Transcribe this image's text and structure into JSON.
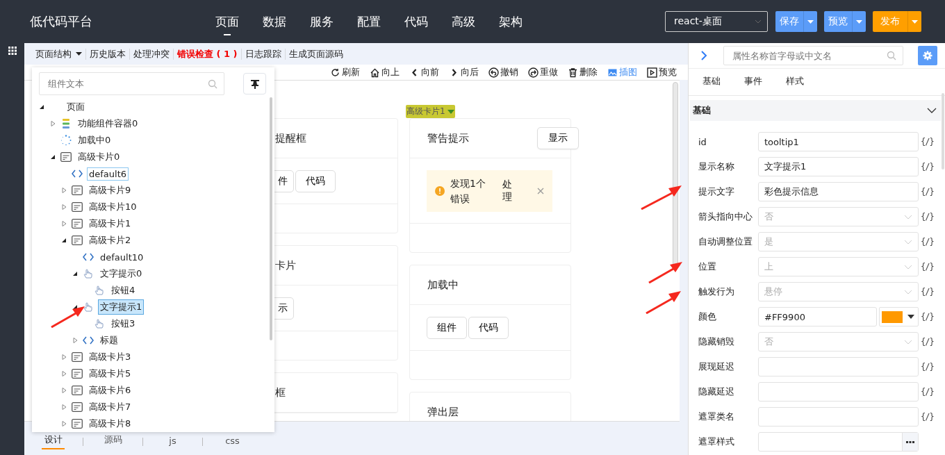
{
  "header": {
    "title": "低代码平台",
    "nav": [
      {
        "label": "页面",
        "selected": true
      },
      {
        "label": "数据",
        "selected": false
      },
      {
        "label": "服务",
        "selected": false
      },
      {
        "label": "配置",
        "selected": false
      },
      {
        "label": "代码",
        "selected": false
      },
      {
        "label": "高级",
        "selected": false
      },
      {
        "label": "架构",
        "selected": false
      }
    ],
    "env_select": {
      "value": "react-桌面"
    },
    "buttons": [
      {
        "label": "保存",
        "kind": "primary"
      },
      {
        "label": "预览",
        "kind": "primary"
      },
      {
        "label": "发布",
        "kind": "warning"
      }
    ]
  },
  "subtoolbar": [
    {
      "label": "页面结构",
      "kind": "dropdown"
    },
    {
      "label": "历史版本",
      "kind": "plain"
    },
    {
      "label": "处理冲突",
      "kind": "plain"
    },
    {
      "label": "错误检查 ( 1 )",
      "kind": "error"
    },
    {
      "label": "日志跟踪",
      "kind": "plain"
    },
    {
      "label": "生成页面源码",
      "kind": "plain"
    }
  ],
  "structure_panel": {
    "search": {
      "placeholder": "组件文本"
    },
    "tree": [
      {
        "label": "页面",
        "expanded": true,
        "selected": false,
        "hovered": false,
        "children": [
          {
            "label": "功能组件容器0",
            "kind": "container",
            "expanded": false,
            "selected": false,
            "hovered": false
          },
          {
            "label": "加载中0",
            "kind": "loading",
            "selected": false,
            "hovered": false
          },
          {
            "label": "高级卡片0",
            "kind": "card",
            "expanded": true,
            "selected": false,
            "hovered": false,
            "children": [
              {
                "label": "default6",
                "kind": "slot",
                "selected": false,
                "hovered": true
              },
              {
                "label": "高级卡片9",
                "kind": "card",
                "expanded": false,
                "selected": false,
                "hovered": false
              },
              {
                "label": "高级卡片10",
                "kind": "card",
                "expanded": false,
                "selected": false,
                "hovered": false
              },
              {
                "label": "高级卡片1",
                "kind": "card",
                "expanded": false,
                "selected": false,
                "hovered": false
              },
              {
                "label": "高级卡片2",
                "kind": "card",
                "expanded": true,
                "selected": false,
                "hovered": false,
                "children": [
                  {
                    "label": "default10",
                    "kind": "slot",
                    "selected": false,
                    "hovered": false
                  },
                  {
                    "label": "文字提示0",
                    "kind": "pointer",
                    "expanded": true,
                    "selected": false,
                    "hovered": false,
                    "children": [
                      {
                        "label": "按钮4",
                        "kind": "pointer",
                        "selected": false,
                        "hovered": false
                      }
                    ]
                  },
                  {
                    "label": "文字提示1",
                    "kind": "pointer",
                    "expanded": true,
                    "selected": true,
                    "hovered": false,
                    "children": [
                      {
                        "label": "按钮3",
                        "kind": "pointer",
                        "selected": false,
                        "hovered": false
                      }
                    ]
                  },
                  {
                    "label": "标题",
                    "kind": "slot",
                    "expanded": false,
                    "selected": false,
                    "hovered": false
                  }
                ]
              },
              {
                "label": "高级卡片3",
                "kind": "card",
                "expanded": false,
                "selected": false,
                "hovered": false
              },
              {
                "label": "高级卡片5",
                "kind": "card",
                "expanded": false,
                "selected": false,
                "hovered": false
              },
              {
                "label": "高级卡片6",
                "kind": "card",
                "expanded": false,
                "selected": false,
                "hovered": false
              },
              {
                "label": "高级卡片7",
                "kind": "card",
                "expanded": false,
                "selected": false,
                "hovered": false
              },
              {
                "label": "高级卡片8",
                "kind": "card",
                "expanded": false,
                "selected": false,
                "hovered": false
              }
            ]
          }
        ]
      }
    ]
  },
  "canvas": {
    "actions": [
      {
        "label": "刷新",
        "kind": "refresh",
        "active": false
      },
      {
        "label": "向上",
        "kind": "home",
        "active": false
      },
      {
        "label": "向前",
        "kind": "prev",
        "active": false
      },
      {
        "label": "向后",
        "kind": "next",
        "active": false
      },
      {
        "label": "撤销",
        "kind": "undo",
        "active": false
      },
      {
        "label": "重做",
        "kind": "redo",
        "active": false
      },
      {
        "label": "删除",
        "kind": "delete",
        "active": false
      },
      {
        "label": "插图",
        "kind": "image",
        "active": true
      },
      {
        "label": "预览",
        "kind": "play",
        "active": false
      }
    ],
    "selection_tag": "高级卡片1",
    "card_columns": [
      [
        {
          "title": "提醒框",
          "buttons": [
            "件",
            "代码"
          ]
        },
        {
          "title": "卡片",
          "buttons": [
            "示"
          ]
        },
        {
          "title": "框"
        }
      ],
      [
        {
          "title": "警告提示",
          "header_button": "显示",
          "alert": {
            "text": "发现1个错误",
            "action": "处理"
          }
        },
        {
          "title": "加载中",
          "buttons": [
            "组件",
            "代码"
          ]
        },
        {
          "title": "弹出层"
        }
      ]
    ]
  },
  "bottom_tabs": [
    {
      "label": "设计",
      "selected": true
    },
    {
      "label": "源码",
      "selected": false
    },
    {
      "label": "js",
      "selected": false
    },
    {
      "label": "css",
      "selected": false
    }
  ],
  "properties": {
    "search": {
      "placeholder": "属性名称首字母或中文名"
    },
    "tabs": [
      {
        "label": "基础"
      },
      {
        "label": "事件"
      },
      {
        "label": "样式"
      }
    ],
    "section": {
      "title": "基础",
      "expanded": true
    },
    "fields": [
      {
        "label": "id",
        "kind": "text",
        "value": "tooltip1",
        "binding": "{/}"
      },
      {
        "label": "显示名称",
        "kind": "text",
        "value": "文字提示1",
        "binding": "{/}"
      },
      {
        "label": "提示文字",
        "kind": "text",
        "value": "彩色提示信息",
        "binding": "{/}"
      },
      {
        "label": "箭头指向中心",
        "kind": "select",
        "placeholder": "否",
        "binding": "{/}"
      },
      {
        "label": "自动调整位置",
        "kind": "select",
        "placeholder": "是",
        "binding": "{/}"
      },
      {
        "label": "位置",
        "kind": "select",
        "placeholder": "上",
        "binding": "{/}"
      },
      {
        "label": "触发行为",
        "kind": "select",
        "placeholder": "悬停",
        "binding": "{/}"
      },
      {
        "label": "颜色",
        "kind": "color",
        "value": "#FF9900",
        "color": "#ff9900",
        "binding": "{/}"
      },
      {
        "label": "隐藏销毁",
        "kind": "select",
        "placeholder": "否",
        "binding": "{/}"
      },
      {
        "label": "展现延迟",
        "kind": "text",
        "binding": "{/}"
      },
      {
        "label": "隐藏延迟",
        "kind": "text",
        "binding": "{/}"
      },
      {
        "label": "遮罩类名",
        "kind": "text",
        "binding": "{/}"
      },
      {
        "label": "遮罩样式",
        "kind": "more"
      }
    ]
  }
}
